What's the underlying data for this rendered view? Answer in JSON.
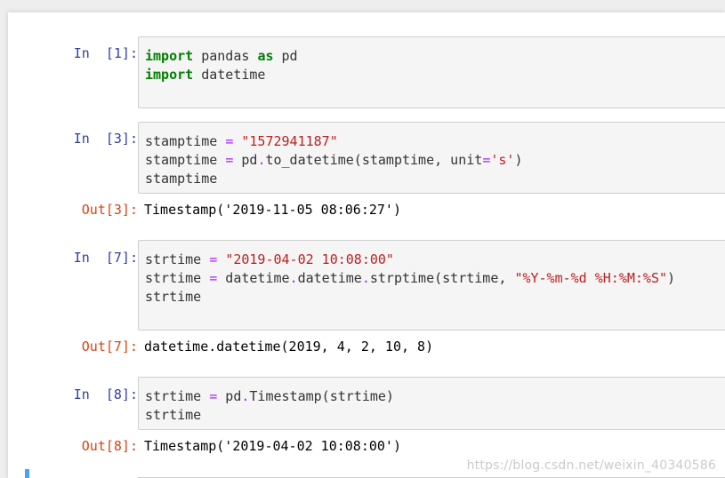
{
  "cells": [
    {
      "prompt": "In  [1]:",
      "lines": [
        [
          {
            "t": "import",
            "c": "kw"
          },
          {
            "t": " pandas ",
            "c": ""
          },
          {
            "t": "as",
            "c": "kw"
          },
          {
            "t": " pd",
            "c": ""
          }
        ],
        [
          {
            "t": "import",
            "c": "kw"
          },
          {
            "t": " datetime",
            "c": ""
          }
        ]
      ]
    },
    {
      "prompt": "In  [3]:",
      "lines": [
        [
          {
            "t": "stamptime ",
            "c": ""
          },
          {
            "t": "=",
            "c": "op"
          },
          {
            "t": " ",
            "c": ""
          },
          {
            "t": "\"1572941187\"",
            "c": "str"
          }
        ],
        [
          {
            "t": "stamptime ",
            "c": ""
          },
          {
            "t": "=",
            "c": "op"
          },
          {
            "t": " pd",
            "c": ""
          },
          {
            "t": ".",
            "c": "op"
          },
          {
            "t": "to_datetime(stamptime, unit",
            "c": ""
          },
          {
            "t": "=",
            "c": "op"
          },
          {
            "t": "'s'",
            "c": "str"
          },
          {
            "t": ")",
            "c": ""
          }
        ],
        [
          {
            "t": "stamptime",
            "c": ""
          }
        ]
      ],
      "out_prompt": "Out[3]:",
      "output": "Timestamp('2019-11-05 08:06:27')"
    },
    {
      "prompt": "In  [7]:",
      "lines": [
        [
          {
            "t": "strtime ",
            "c": ""
          },
          {
            "t": "=",
            "c": "op"
          },
          {
            "t": " ",
            "c": ""
          },
          {
            "t": "\"2019-04-02 10:08:00\"",
            "c": "str"
          }
        ],
        [
          {
            "t": "strtime ",
            "c": ""
          },
          {
            "t": "=",
            "c": "op"
          },
          {
            "t": " datetime",
            "c": ""
          },
          {
            "t": ".",
            "c": "op"
          },
          {
            "t": "datetime",
            "c": ""
          },
          {
            "t": ".",
            "c": "op"
          },
          {
            "t": "strptime(strtime, ",
            "c": ""
          },
          {
            "t": "\"%Y-%m-%d %H:%M:%S\"",
            "c": "str"
          },
          {
            "t": ")",
            "c": ""
          }
        ],
        [
          {
            "t": "strtime",
            "c": ""
          }
        ]
      ],
      "out_prompt": "Out[7]:",
      "output": "datetime.datetime(2019, 4, 2, 10, 8)"
    },
    {
      "prompt": "In  [8]:",
      "lines": [
        [
          {
            "t": "strtime ",
            "c": ""
          },
          {
            "t": "=",
            "c": "op"
          },
          {
            "t": " pd",
            "c": ""
          },
          {
            "t": ".",
            "c": "op"
          },
          {
            "t": "Timestamp(strtime)",
            "c": ""
          }
        ],
        [
          {
            "t": "strtime",
            "c": ""
          }
        ]
      ],
      "out_prompt": "Out[8]:",
      "output": "Timestamp('2019-04-02 10:08:00')"
    }
  ],
  "watermark": "https://blog.csdn.net/weixin_40340586",
  "colors": {
    "keyword": "#008000",
    "operator": "#aa22ff",
    "string": "#ba2121",
    "in_prompt": "#303f9f",
    "out_prompt": "#d84315"
  }
}
